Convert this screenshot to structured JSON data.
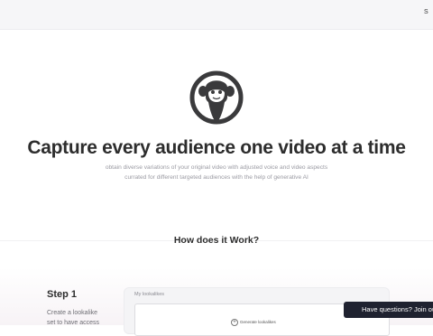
{
  "header": {
    "link_label": "S"
  },
  "hero": {
    "title": "Capture every audience one video at a time",
    "subtitle_line1": "obtain diverse variations of your original video with adjusted voice and video aspects",
    "subtitle_line2": "currated for different targeted audiences with the help of generative AI"
  },
  "how": {
    "title": "How does it Work?"
  },
  "step1": {
    "title": "Step 1",
    "description": "Create a lookalike set to have access"
  },
  "lookalikes_panel": {
    "title": "My lookalikes",
    "generate_label": "Generate lookalikes"
  },
  "chat": {
    "label": "Have questions? Join our"
  },
  "icons": {
    "logo": "monkey-logo-icon",
    "generate": "plus-circle-icon"
  },
  "colors": {
    "chat_bg": "#1f2230",
    "logo": "#3a3a3c"
  }
}
